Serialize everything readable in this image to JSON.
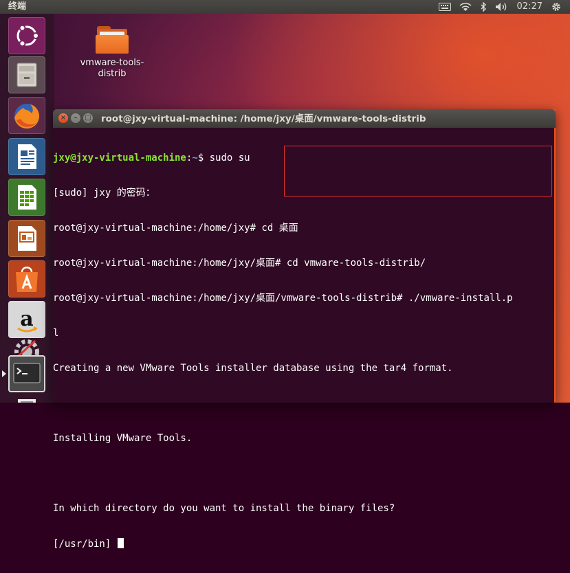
{
  "top_panel": {
    "title": "终端",
    "clock": "02:27"
  },
  "desktop": {
    "icon_label": "vmware-tools-distrib"
  },
  "launcher": {
    "items": [
      {
        "name": "dash-icon"
      },
      {
        "name": "files-icon"
      },
      {
        "name": "firefox-icon"
      },
      {
        "name": "writer-icon"
      },
      {
        "name": "calc-icon"
      },
      {
        "name": "impress-icon"
      },
      {
        "name": "software-center-icon"
      },
      {
        "name": "amazon-icon"
      },
      {
        "name": "settings-icon"
      },
      {
        "name": "terminal-icon"
      },
      {
        "name": "removable-drive-icon"
      }
    ]
  },
  "terminal": {
    "title": "root@jxy-virtual-machine: /home/jxy/桌面/vmware-tools-distrib",
    "line1": {
      "user": "jxy@jxy-virtual-machine",
      "colon": ":",
      "path": "~",
      "cmd": "$ sudo su"
    },
    "lines": [
      "[sudo] jxy 的密码：",
      "root@jxy-virtual-machine:/home/jxy# cd 桌面",
      "root@jxy-virtual-machine:/home/jxy/桌面# cd vmware-tools-distrib/",
      "root@jxy-virtual-machine:/home/jxy/桌面/vmware-tools-distrib# ./vmware-install.p",
      "l",
      "Creating a new VMware Tools installer database using the tar4 format.",
      "",
      "Installing VMware Tools.",
      "",
      "In which directory do you want to install the binary files?"
    ],
    "prompt": "[/usr/bin] "
  },
  "colors": {
    "terminal_bg": "#300a24",
    "accent": "#e95420",
    "user_green": "#8ae234",
    "path_blue": "#729fcf",
    "highlight_box": "#e0302a"
  }
}
